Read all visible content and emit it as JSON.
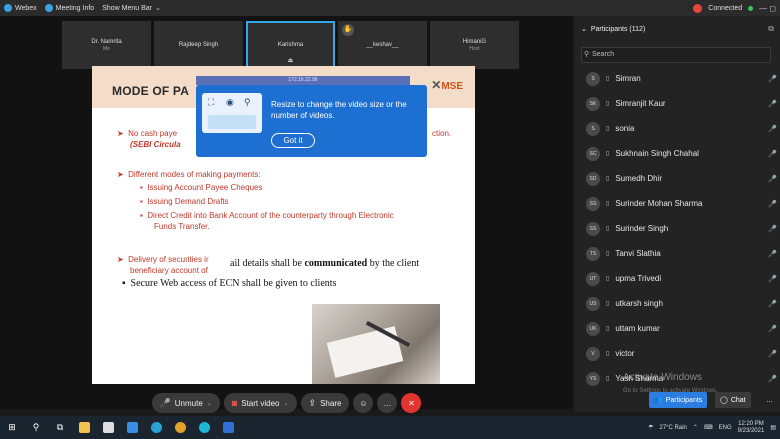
{
  "topbar": {
    "app": "Webex",
    "meeting_info": "Meeting Info",
    "menu": "Show Menu Bar",
    "connected": "Connected",
    "win_controls": "— ◻"
  },
  "strip": [
    {
      "name": "Dr. Namrita",
      "sub": "Me"
    },
    {
      "name": "Rajdeep Singh",
      "sub": ""
    },
    {
      "name": "Karishma",
      "sub": "",
      "active": true
    },
    {
      "name": "__keshav__",
      "sub": ""
    },
    {
      "name": "HimaniG",
      "sub": "Host"
    }
  ],
  "slide": {
    "title": "MODE OF PA",
    "logo": "MSE",
    "line1": "No cash paye",
    "line1_end": "ction.",
    "line2": "(SEBI Circula",
    "modes_head": "Different modes of making payments:",
    "modes": [
      "Issuing Account Payee Cheques",
      "Issuing Demand Drafts",
      "Direct Credit into Bank Account of the counterparty through Electronic",
      "Funds Transfer."
    ],
    "delivery1": "Delivery of securities ir",
    "delivery2": "beneficiary account of",
    "serif_line_pre": "ail details shall be ",
    "serif_line_bold": "communicated",
    "serif_line_post": " by the client",
    "serif_line2": "Secure Web access of ECN shall be given to clients"
  },
  "popup": {
    "header": "172.16.22.96",
    "message": "Resize to change the video size or the number of videos.",
    "button": "Got it"
  },
  "controls": {
    "unmute": "Unmute",
    "start_video": "Start video",
    "share": "Share"
  },
  "panel": {
    "title": "Participants (112)",
    "search_placeholder": "Search",
    "participants": [
      {
        "initials": "S",
        "name": "Simran"
      },
      {
        "initials": "SK",
        "name": "Simranjit Kaur"
      },
      {
        "initials": "S",
        "name": "sonia"
      },
      {
        "initials": "SC",
        "name": "Sukhnain Singh Chahal"
      },
      {
        "initials": "SD",
        "name": "Sumedh Dhir"
      },
      {
        "initials": "SS",
        "name": "Surinder Mohan Sharma"
      },
      {
        "initials": "SS",
        "name": "Surinder Singh"
      },
      {
        "initials": "TS",
        "name": "Tanvi Slathia"
      },
      {
        "initials": "UT",
        "name": "upma Trivedi"
      },
      {
        "initials": "US",
        "name": "utkarsh singh"
      },
      {
        "initials": "UK",
        "name": "uttam kumar"
      },
      {
        "initials": "V",
        "name": "victor"
      },
      {
        "initials": "YS",
        "name": "Yash Sharma"
      }
    ],
    "participants_btn": "Participants",
    "chat_btn": "Chat",
    "watermark": "Activate Windows",
    "watermark_sub": "Go to Settings to activate Windows."
  },
  "taskbar": {
    "weather": "27°C Rain",
    "lang": "ENG",
    "time": "12:20 PM",
    "date": "9/23/2021"
  },
  "colors": {
    "accent": "#1d6fd1",
    "end_call": "#e3352f",
    "slide_text": "#c0392b"
  }
}
